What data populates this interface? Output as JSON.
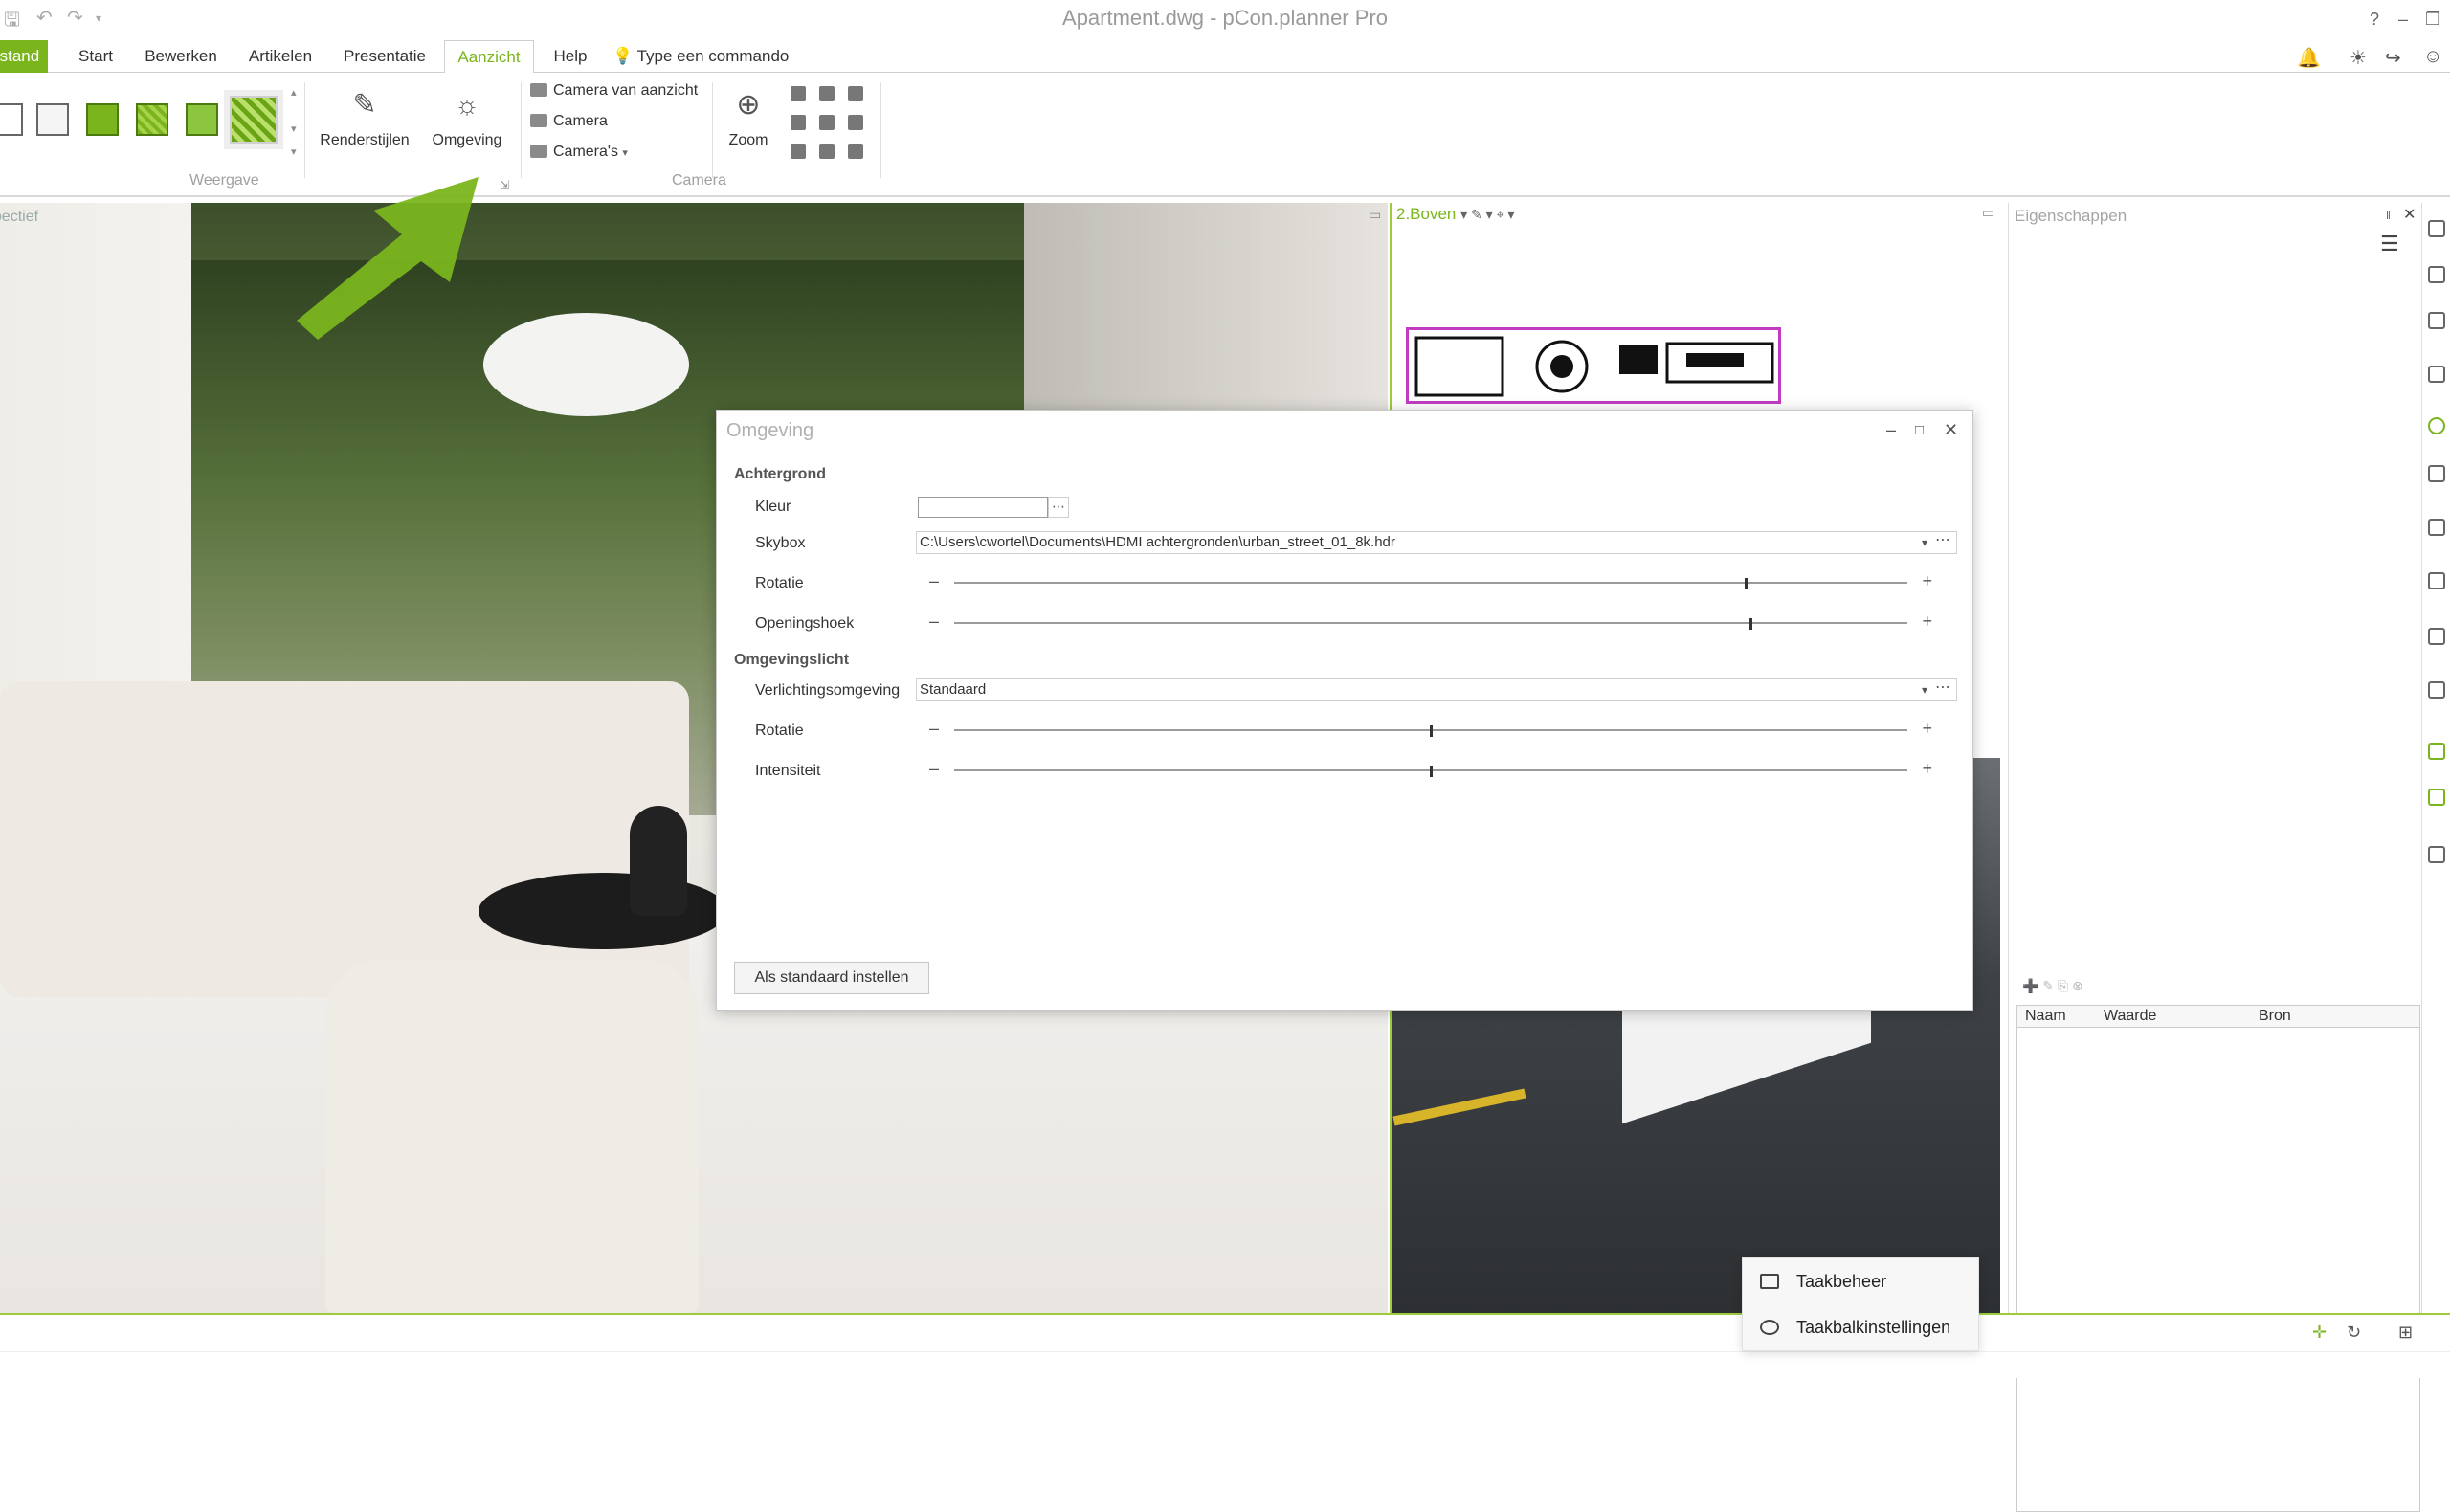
{
  "app": {
    "title": "Apartment.dwg - pCon.planner Pro"
  },
  "tabs": [
    {
      "label": "Bestand"
    },
    {
      "label": "Start"
    },
    {
      "label": "Bewerken"
    },
    {
      "label": "Artikelen"
    },
    {
      "label": "Presentatie"
    },
    {
      "label": "Aanzicht"
    },
    {
      "label": "Help"
    }
  ],
  "command_search": {
    "placeholder": "Type een commando"
  },
  "ribbon": {
    "weergave": {
      "group_label": "Weergave",
      "renderstijlen": "Renderstijlen",
      "omgeving": "Omgeving"
    },
    "camera": {
      "group_label": "Camera",
      "camera_van_aanzicht": "Camera van aanzicht",
      "camera": "Camera",
      "cameras": "Camera's",
      "zoom": "Zoom"
    }
  },
  "viewports": {
    "left_caption": "Perspectief",
    "right_caption": "2.Boven"
  },
  "properties": {
    "title": "Eigenschappen",
    "columns": [
      "Naam",
      "Waarde",
      "Bron"
    ]
  },
  "dialog": {
    "title": "Omgeving",
    "background_section": "Achtergrond",
    "kleur_label": "Kleur",
    "skybox_label": "Skybox",
    "skybox_value": "C:\\Users\\cwortel\\Documents\\HDMI achtergronden\\urban_street_01_8k.hdr",
    "rotatie_label": "Rotatie",
    "rotatie_value": 0.83,
    "openingshoek_label": "Openingshoek",
    "openingshoek_value": 0.835,
    "light_section": "Omgevingslicht",
    "verlichting_label": "Verlichtingsomgeving",
    "verlichting_value": "Standaard",
    "licht_rotatie_label": "Rotatie",
    "licht_rotatie_value": 0.5,
    "intensiteit_label": "Intensiteit",
    "intensiteit_value": 0.5,
    "default_button": "Als standaard instellen"
  },
  "context_menu": {
    "items": [
      {
        "label": "Taakbeheer",
        "icon": "task-manager-icon"
      },
      {
        "label": "Taakbalkinstellingen",
        "icon": "gear-icon"
      }
    ]
  },
  "colors": {
    "accent": "#7ab51d",
    "highlight_border": "#9ccc3c",
    "plan_outline": "#c23cc2"
  }
}
